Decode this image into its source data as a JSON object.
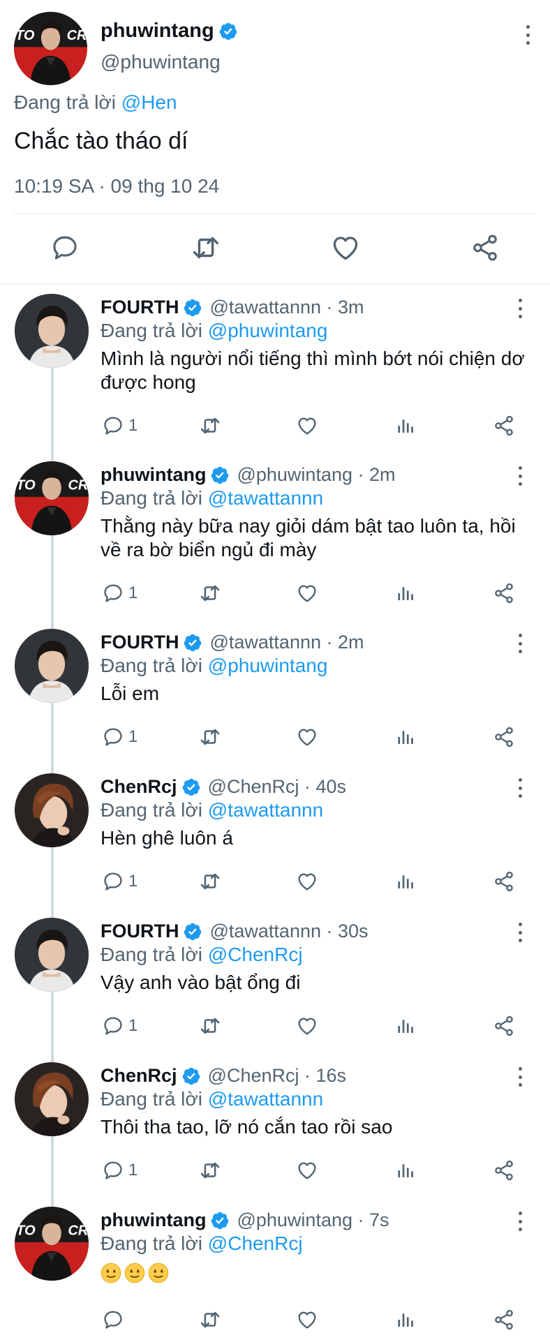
{
  "main_tweet": {
    "display_name": "phuwintang",
    "handle": "@phuwintang",
    "replying_label": "Đang trả lời",
    "replying_to": "@Hen",
    "text": "Chắc tào tháo dí",
    "timestamp": "10:19 SA · 09 thg 10 24",
    "avatar_text": "TO CR"
  },
  "replies": [
    {
      "display_name": "FOURTH",
      "handle_time": "@tawattannn · 3m",
      "replying_label": "Đang trả lời",
      "replying_to": "@phuwintang",
      "text": "Mình là người nổi tiếng thì mình bớt nói chiện dơ được hong",
      "reply_count": "1"
    },
    {
      "display_name": "phuwintang",
      "handle_time": "@phuwintang · 2m",
      "replying_label": "Đang trả lời",
      "replying_to": "@tawattannn",
      "text": "Thằng này bữa nay giỏi dám bật tao luôn ta, hồi về ra bờ biển ngủ đi mày",
      "reply_count": "1",
      "avatar_text": "TO CR"
    },
    {
      "display_name": "FOURTH",
      "handle_time": "@tawattannn · 2m",
      "replying_label": "Đang trả lời",
      "replying_to": "@phuwintang",
      "text": "Lỗi em",
      "reply_count": "1"
    },
    {
      "display_name": "ChenRcj",
      "handle_time": "@ChenRcj · 40s",
      "replying_label": "Đang trả lời",
      "replying_to": "@tawattannn",
      "text": "Hèn ghê luôn á",
      "reply_count": "1"
    },
    {
      "display_name": "FOURTH",
      "handle_time": "@tawattannn · 30s",
      "replying_label": "Đang trả lời",
      "replying_to": "@ChenRcj",
      "text": "Vậy anh vào bật ổng đi",
      "reply_count": "1"
    },
    {
      "display_name": "ChenRcj",
      "handle_time": "@ChenRcj · 16s",
      "replying_label": "Đang trả lời",
      "replying_to": "@tawattannn",
      "text": "Thôi tha tao, lỡ nó cắn tao rồi sao",
      "reply_count": "1"
    },
    {
      "display_name": "phuwintang",
      "handle_time": "@phuwintang · 7s",
      "replying_label": "Đang trả lời",
      "replying_to": "@ChenRcj",
      "text": "",
      "reply_count": "",
      "avatar_text": "TO CR"
    }
  ],
  "colors": {
    "link": "#1d9bf0",
    "secondary_text": "#536471",
    "primary_text": "#0f1419",
    "verified": "#1d9bf0"
  }
}
